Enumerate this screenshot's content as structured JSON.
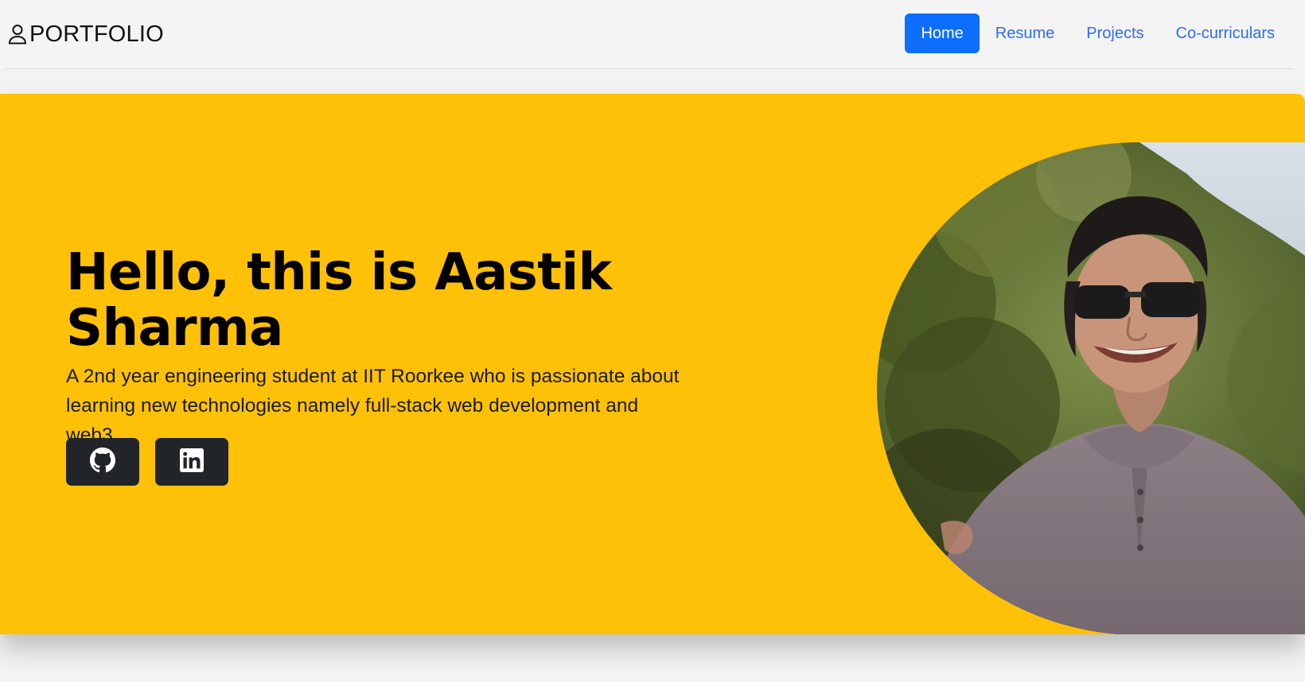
{
  "header": {
    "brand": "PORTFOLIO",
    "brand_icon": "person-icon",
    "nav": [
      {
        "label": "Home",
        "active": true
      },
      {
        "label": "Resume",
        "active": false
      },
      {
        "label": "Projects",
        "active": false
      },
      {
        "label": "Co-curriculars",
        "active": false
      }
    ]
  },
  "hero": {
    "title": "Hello, this is Aastik Sharma",
    "description": "A 2nd year engineering student at IIT Roorkee who is passionate about learning new technologies namely full-stack web development and web3.",
    "social": [
      {
        "icon": "github-icon"
      },
      {
        "icon": "linkedin-icon"
      }
    ]
  },
  "colors": {
    "accent": "#0d6efd",
    "link": "#2f6cf5",
    "hero_bg": "#ffc107",
    "button_dark": "#212529"
  }
}
